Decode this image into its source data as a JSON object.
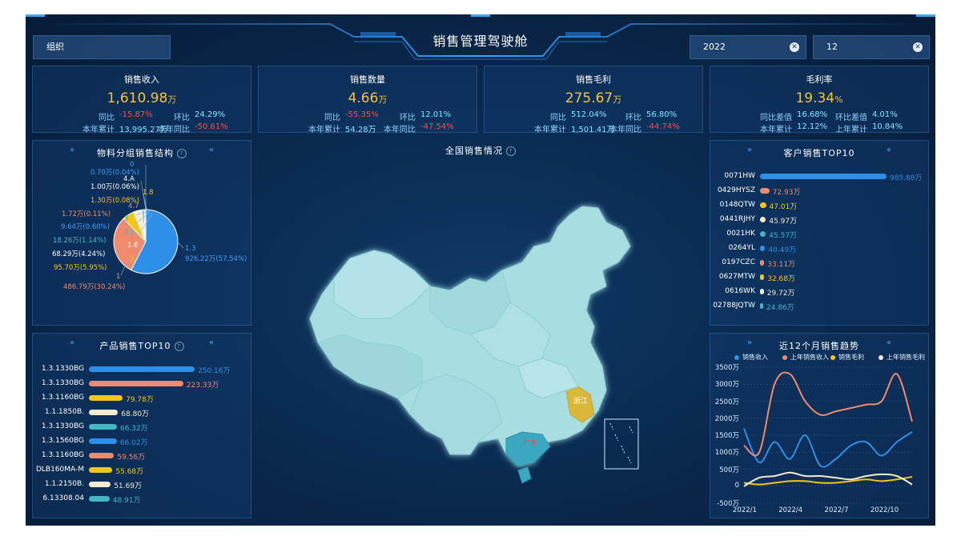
{
  "header": {
    "title": "销售管理驾驶舱"
  },
  "filters": {
    "org_label": "组织",
    "year": "2022",
    "month": "12",
    "clear_icon": "close-circle-icon"
  },
  "kpis": [
    {
      "name": "销售收入",
      "value": "1,610.98",
      "unit": "万",
      "l1": "同比",
      "v1": "-15.87%",
      "l2": "环比",
      "v2": "24.29%",
      "l3": "本年累计",
      "v3": "13,995.27万",
      "l4": "本年同比",
      "v4": "-50.61%"
    },
    {
      "name": "销售数量",
      "value": "4.66",
      "unit": "万",
      "l1": "同比",
      "v1": "-55.35%",
      "l2": "环比",
      "v2": "12.01%",
      "l3": "本年累计",
      "v3": "54.28万",
      "l4": "本年同比",
      "v4": "-47.54%"
    },
    {
      "name": "销售毛利",
      "value": "275.67",
      "unit": "万",
      "l1": "同比",
      "v1": "512.04%",
      "l2": "环比",
      "v2": "56.80%",
      "l3": "本年累计",
      "v3": "1,501.41万",
      "l4": "本年同比",
      "v4": "-44.74%"
    },
    {
      "name": "毛利率",
      "value": "19.34",
      "unit": "%",
      "l1": "同比差值",
      "v1": "16.68%",
      "l2": "环比差值",
      "v2": "4.01%",
      "l3": "本年累计",
      "v3": "12.12%",
      "l4": "上年累计",
      "v4": "10.84%"
    }
  ],
  "material": {
    "title": "物料分组销售结构",
    "labels": [
      {
        "text": "0",
        "color": "#3aa0ff"
      },
      {
        "text": "0.70万(0.04%)",
        "color": "#3aa0ff"
      },
      {
        "text": "4.A",
        "color": "#ffffff"
      },
      {
        "text": "1.00万(0.06%)",
        "color": "#ffffff"
      },
      {
        "text": "1.8",
        "color": "#f5c518"
      },
      {
        "text": "1.30万(0.08%)",
        "color": "#f5c518"
      },
      {
        "text": "4.7",
        "color": "#f08a6a"
      },
      {
        "text": "1.72万(0.11%)",
        "color": "#f08a6a"
      },
      {
        "text": "3",
        "color": "#3aa0ff"
      },
      {
        "text": "9.64万(0.60%)",
        "color": "#3aa0ff"
      },
      {
        "text": "3.L",
        "color": "#44b6c4"
      },
      {
        "text": "18.26万(1.14%)",
        "color": "#44b6c4"
      },
      {
        "text": "1.6",
        "color": "#ffffff"
      },
      {
        "text": "68.29万(4.24%)",
        "color": "#ffffff"
      },
      {
        "text": "6",
        "color": "#f5c518"
      },
      {
        "text": "95.70万(5.95%)",
        "color": "#f5c518"
      },
      {
        "text": "1.3",
        "color": "#3aa0ff"
      },
      {
        "text": "926.22万(57.54%)",
        "color": "#3aa0ff"
      },
      {
        "text": "1",
        "color": "#f08a6a"
      },
      {
        "text": "486.79万(30.24%)",
        "color": "#f08a6a"
      }
    ]
  },
  "product": {
    "title": "产品销售TOP10",
    "items": [
      {
        "label": "1.3.1330BG",
        "value": "250.16万",
        "v": 250.16,
        "color": "#2e8fe8"
      },
      {
        "label": "1.3.1330BG",
        "value": "223.33万",
        "v": 223.33,
        "color": "#ef8a6c"
      },
      {
        "label": "1.3.1160BG",
        "value": "79.78万",
        "v": 79.78,
        "color": "#f5c518"
      },
      {
        "label": "1.1.1850B.",
        "value": "68.80万",
        "v": 68.8,
        "color": "#f4ead0"
      },
      {
        "label": "1.3.1330BG",
        "value": "66.32万",
        "v": 66.32,
        "color": "#44b6c4"
      },
      {
        "label": "1.3.1560BG",
        "value": "66.02万",
        "v": 66.02,
        "color": "#2e8fe8"
      },
      {
        "label": "1.3.1160BG",
        "value": "59.56万",
        "v": 59.56,
        "color": "#ef8a6c"
      },
      {
        "label": "DLB160MA-M",
        "value": "55.68万",
        "v": 55.68,
        "color": "#f5c518"
      },
      {
        "label": "1.1.2150B.",
        "value": "51.69万",
        "v": 51.69,
        "color": "#f4ead0"
      },
      {
        "label": "6.13308.04",
        "value": "48.91万",
        "v": 48.91,
        "color": "#44b6c4"
      }
    ]
  },
  "map": {
    "title": "全国销售情况",
    "labels": [
      "浙江",
      "广东"
    ]
  },
  "customer": {
    "title": "客户销售TOP10",
    "items": [
      {
        "label": "0071HW",
        "value": "985.88万",
        "v": 985.88,
        "color": "#2e8fe8"
      },
      {
        "label": "0429HYSZ",
        "value": "72.93万",
        "v": 72.93,
        "color": "#ef8a6c"
      },
      {
        "label": "0148QTW",
        "value": "47.01万",
        "v": 47.01,
        "color": "#f5c518"
      },
      {
        "label": "0441RJHY",
        "value": "45.97万",
        "v": 45.97,
        "color": "#f4ead0"
      },
      {
        "label": "0021HK",
        "value": "45.57万",
        "v": 45.57,
        "color": "#44b6c4"
      },
      {
        "label": "0264YL",
        "value": "40.49万",
        "v": 40.49,
        "color": "#2e8fe8"
      },
      {
        "label": "0197CZC",
        "value": "33.11万",
        "v": 33.11,
        "color": "#ef8a6c"
      },
      {
        "label": "0627MTW",
        "value": "32.68万",
        "v": 32.68,
        "color": "#f5c518"
      },
      {
        "label": "0616WK",
        "value": "29.72万",
        "v": 29.72,
        "color": "#f4ead0"
      },
      {
        "label": "02788JQTW",
        "value": "24.86万",
        "v": 24.86,
        "color": "#44b6c4"
      }
    ]
  },
  "trend": {
    "title": "近12个月销售趋势"
  },
  "chart_data": [
    {
      "type": "pie",
      "categories": [
        "1.3",
        "1",
        "6",
        "1.6",
        "3.L",
        "3",
        "4.7",
        "1.8",
        "4.A",
        "0"
      ],
      "values": [
        926.22,
        486.79,
        95.7,
        68.29,
        18.26,
        9.64,
        1.72,
        1.3,
        1.0,
        0.7
      ],
      "colors": [
        "#2e8fe8",
        "#ef8a6c",
        "#f5c518",
        "#f4ead0",
        "#44b6c4",
        "#2e8fe8",
        "#ef8a6c",
        "#f5c518",
        "#f4ead0",
        "#44b6c4"
      ]
    },
    {
      "type": "line",
      "x": [
        "2022/1",
        "2022/2",
        "2022/3",
        "2022/4",
        "2022/5",
        "2022/6",
        "2022/7",
        "2022/8",
        "2022/9",
        "2022/10",
        "2022/11",
        "2022/12"
      ],
      "xticks": [
        "2022/1",
        "2022/4",
        "2022/7",
        "2022/10"
      ],
      "ylim": [
        -500,
        3500
      ],
      "yticks": [
        "3500万",
        "3000万",
        "2500万",
        "2000万",
        "1500万",
        "1000万",
        "500万",
        "0",
        "-500万"
      ],
      "series": [
        {
          "name": "销售收入",
          "color": "#2e8fe8",
          "values": [
            1700,
            700,
            1300,
            800,
            1500,
            600,
            800,
            1200,
            1300,
            900,
            1300,
            1600
          ]
        },
        {
          "name": "上年销售收入",
          "color": "#ef8a6c",
          "values": [
            1200,
            1000,
            3000,
            3300,
            2500,
            2100,
            2200,
            2300,
            2400,
            2500,
            3300,
            1900
          ]
        },
        {
          "name": "销售毛利",
          "color": "#f5c518",
          "values": [
            100,
            50,
            100,
            150,
            150,
            100,
            100,
            150,
            200,
            150,
            200,
            275
          ]
        },
        {
          "name": "上年销售毛利",
          "color": "#f4ead0",
          "values": [
            0,
            250,
            300,
            400,
            300,
            300,
            250,
            200,
            300,
            350,
            300,
            50
          ]
        }
      ]
    }
  ]
}
